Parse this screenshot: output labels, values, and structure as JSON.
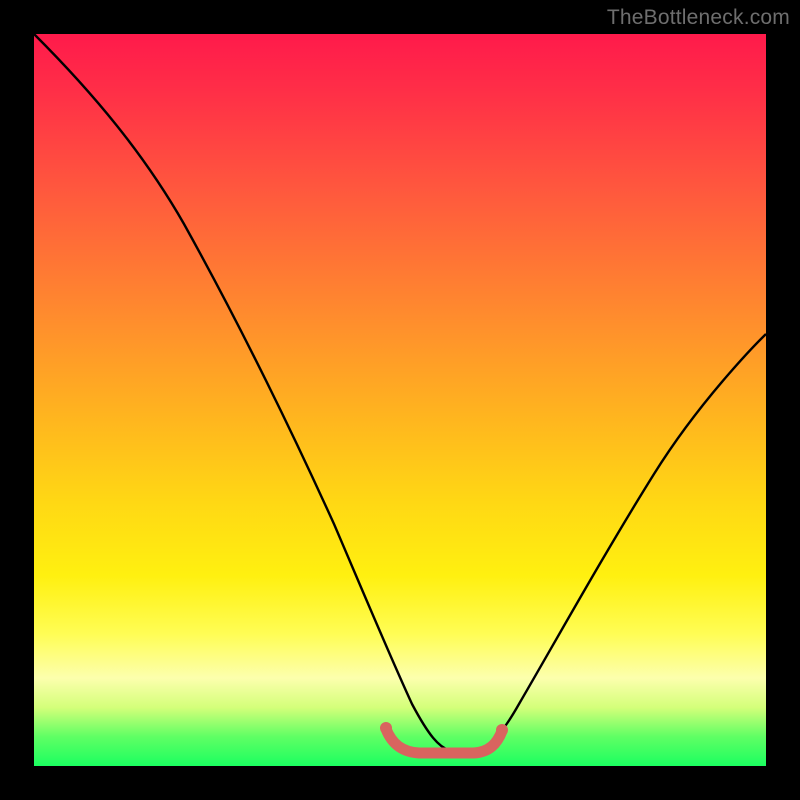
{
  "watermark": "TheBottleneck.com",
  "chart_data": {
    "type": "line",
    "title": "",
    "xlabel": "",
    "ylabel": "",
    "xlim": [
      0,
      100
    ],
    "ylim": [
      0,
      100
    ],
    "grid": false,
    "series": [
      {
        "name": "curve",
        "x": [
          0,
          5,
          10,
          15,
          20,
          25,
          30,
          35,
          40,
          45,
          48,
          50,
          52,
          56,
          60,
          62,
          64,
          70,
          80,
          90,
          100
        ],
        "values": [
          100,
          94,
          87,
          79,
          70,
          60,
          49,
          37,
          25,
          13,
          7,
          4,
          3,
          3,
          3,
          4,
          6,
          13,
          27,
          41,
          55
        ]
      },
      {
        "name": "valley-marker",
        "x": [
          48,
          50,
          52,
          54,
          56,
          58,
          60,
          62
        ],
        "values": [
          5,
          3,
          2.5,
          2.5,
          2.5,
          2.5,
          3.2,
          5
        ]
      }
    ],
    "colors": {
      "curve": "#000000",
      "valley_marker": "#d9645f",
      "gradient_top": "#ff1a4b",
      "gradient_bottom": "#1bff60"
    }
  }
}
